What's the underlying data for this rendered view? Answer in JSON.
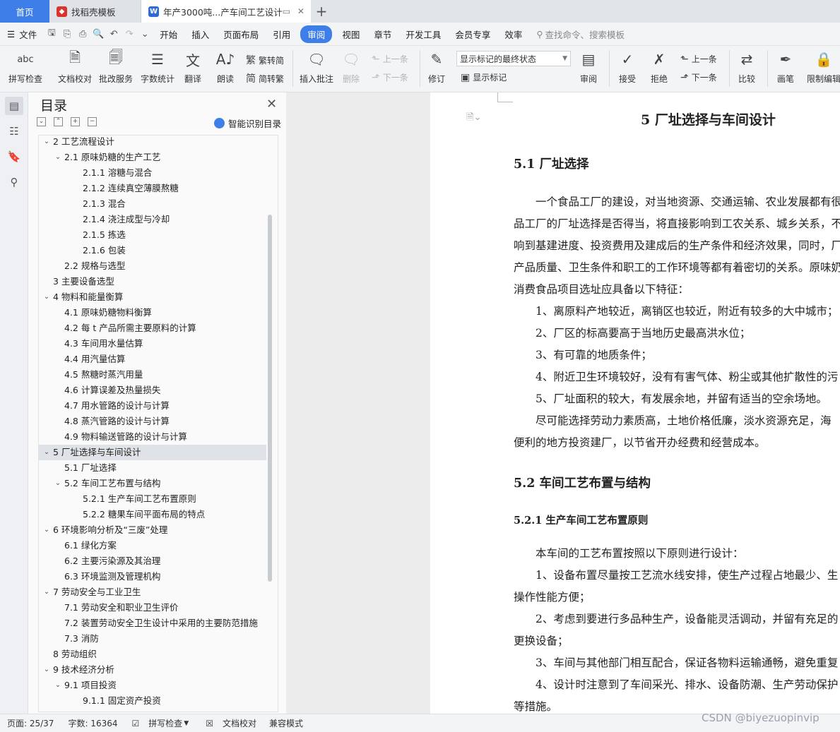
{
  "tabs": {
    "home": "首页",
    "template": "找稻壳模板",
    "document": "年产3000吨...产车间工艺设计"
  },
  "menu": {
    "file": "文件",
    "items": [
      "开始",
      "插入",
      "页面布局",
      "引用",
      "审阅",
      "视图",
      "章节",
      "开发工具",
      "会员专享",
      "效率"
    ],
    "active": "审阅",
    "search": "查找命令、搜索模板"
  },
  "ribbon": {
    "spell": "拼写检查",
    "proof": "文档校对",
    "batch": "批改服务",
    "count": "字数统计",
    "translate": "翻译",
    "read": "朗读",
    "to_trad": "繁转简",
    "to_simp": "简转繁",
    "insert_comment": "插入批注",
    "delete": "删除",
    "prev": "上一条",
    "next": "下一条",
    "revise": "修订",
    "markup_state": "显示标记的最终状态",
    "show_markup": "显示标记",
    "review": "审阅",
    "accept": "接受",
    "reject": "拒绝",
    "prev2": "上一条",
    "next2": "下一条",
    "compare": "比较",
    "pen": "画笔",
    "restrict": "限制编辑"
  },
  "nav": {
    "title": "目录",
    "smart": "智能识别目录",
    "toc": [
      {
        "text": "2 工艺流程设计",
        "level": 0,
        "chev": "v"
      },
      {
        "text": "2.1  原味奶糖的生产工艺",
        "level": 1,
        "chev": "v"
      },
      {
        "text": "2.1.1  溶糖与混合",
        "level": 2,
        "chev": ""
      },
      {
        "text": "2.1.2  连续真空薄膜熬糖",
        "level": 2,
        "chev": ""
      },
      {
        "text": "2.1.3  混合",
        "level": 2,
        "chev": ""
      },
      {
        "text": "2.1.4  浇注成型与冷却",
        "level": 2,
        "chev": ""
      },
      {
        "text": "2.1.5 拣选",
        "level": 2,
        "chev": ""
      },
      {
        "text": "2.1.6 包装",
        "level": 2,
        "chev": ""
      },
      {
        "text": "2.2 规格与选型",
        "level": 1,
        "chev": ""
      },
      {
        "text": "3 主要设备选型",
        "level": 0,
        "chev": ""
      },
      {
        "text": "4 物料和能量衡算",
        "level": 0,
        "chev": "v"
      },
      {
        "text": "4.1  原味奶糖物料衡算",
        "level": 1,
        "chev": ""
      },
      {
        "text": "4.2  每 t 产品所需主要原料的计算",
        "level": 1,
        "chev": ""
      },
      {
        "text": "4.3  车间用水量估算",
        "level": 1,
        "chev": ""
      },
      {
        "text": "4.4 用汽量估算",
        "level": 1,
        "chev": ""
      },
      {
        "text": "4.5 熬糖时蒸汽用量",
        "level": 1,
        "chev": ""
      },
      {
        "text": "4.6 计算误差及热量损失",
        "level": 1,
        "chev": ""
      },
      {
        "text": "4.7 用水管路的设计与计算",
        "level": 1,
        "chev": ""
      },
      {
        "text": "4.8 蒸汽管路的设计与计算",
        "level": 1,
        "chev": ""
      },
      {
        "text": "4.9 物料输送管路的设计与计算",
        "level": 1,
        "chev": ""
      },
      {
        "text": "5 厂址选择与车间设计",
        "level": 0,
        "chev": "v"
      },
      {
        "text": "5.1 厂址选择",
        "level": 1,
        "chev": ""
      },
      {
        "text": "5.2 车间工艺布置与结构",
        "level": 1,
        "chev": "v"
      },
      {
        "text": "5.2.1 生产车间工艺布置原则",
        "level": 2,
        "chev": ""
      },
      {
        "text": "5.2.2 糖果车间平面布局的特点",
        "level": 2,
        "chev": ""
      },
      {
        "text": "6 环境影响分析及“三废”处理",
        "level": 0,
        "chev": "v"
      },
      {
        "text": "6.1 绿化方案",
        "level": 1,
        "chev": ""
      },
      {
        "text": "6.2 主要污染源及其治理",
        "level": 1,
        "chev": ""
      },
      {
        "text": "6.3 环境监测及管理机构",
        "level": 1,
        "chev": ""
      },
      {
        "text": "7 劳动安全与工业卫生",
        "level": 0,
        "chev": "v"
      },
      {
        "text": "7.1 劳动安全和职业卫生评价",
        "level": 1,
        "chev": ""
      },
      {
        "text": "7.2 装置劳动安全卫生设计中采用的主要防范措施",
        "level": 1,
        "chev": ""
      },
      {
        "text": "7.3 消防",
        "level": 1,
        "chev": ""
      },
      {
        "text": "8 劳动组织",
        "level": 0,
        "chev": ""
      },
      {
        "text": "9 技术经济分析",
        "level": 0,
        "chev": "v"
      },
      {
        "text": "9.1 项目投资",
        "level": 1,
        "chev": "v"
      },
      {
        "text": "9.1.1 固定资产投资",
        "level": 2,
        "chev": ""
      }
    ],
    "selected_index": 20
  },
  "doc": {
    "chapter_title": "5 厂址选择与车间设计",
    "sec1": "5.1 厂址选择",
    "p1": [
      "　　一个食品工厂的建设，对当地资源、交通运输、农业发展都有很",
      "品工厂的厂址选择是否得当，将直接影响到工农关系、城乡关系，不",
      "响到基建进度、投资费用及建成后的生产条件和经济效果，同时，厂",
      "产品质量、卫生条件和职工的工作环境等都有着密切的关系。原味奶",
      "消费食品项目选址应具备以下特征："
    ],
    "list1": [
      "　　1、离原料产地较近，离销区也较近，附近有较多的大中城市；",
      "　　2、厂区的标高要高于当地历史最高洪水位；",
      "　　3、有可靠的地质条件；",
      "　　4、附近卫生环境较好，没有有害气体、粉尘或其他扩散性的污",
      "　　5、厂址面积的较大，有发展余地，并留有适当的空余场地。"
    ],
    "p2": [
      "　　尽可能选择劳动力素质高，土地价格低廉，淡水资源充足，海",
      "便利的地方投资建厂，以节省开办经费和经营成本。"
    ],
    "sec2": "5.2 车间工艺布置与结构",
    "sec21": "5.2.1 生产车间工艺布置原则",
    "p3": [
      "　　本车间的工艺布置按照以下原则进行设计：",
      "　　1、设备布置尽量按工艺流水线安排，使生产过程占地最少、生",
      "操作性能方便；",
      "　　2、考虑到要进行多品种生产，设备能灵活调动，并留有充足的",
      "更换设备；",
      "　　3、车间与其他部门相互配合，保证各物料运输通畅，避免重复",
      "　　4、设计时注意到了车间采光、排水、设备防潮、生产劳动保护",
      "等措施。"
    ]
  },
  "status": {
    "page": "页面: 25/37",
    "words": "字数: 16364",
    "spell": "拼写检查",
    "proof": "文档校对",
    "compat": "兼容模式"
  },
  "watermark": "CSDN @biyezuopinvip",
  "colors": {
    "accent": "#3d7ee8",
    "wps_red": "#d9342b"
  }
}
